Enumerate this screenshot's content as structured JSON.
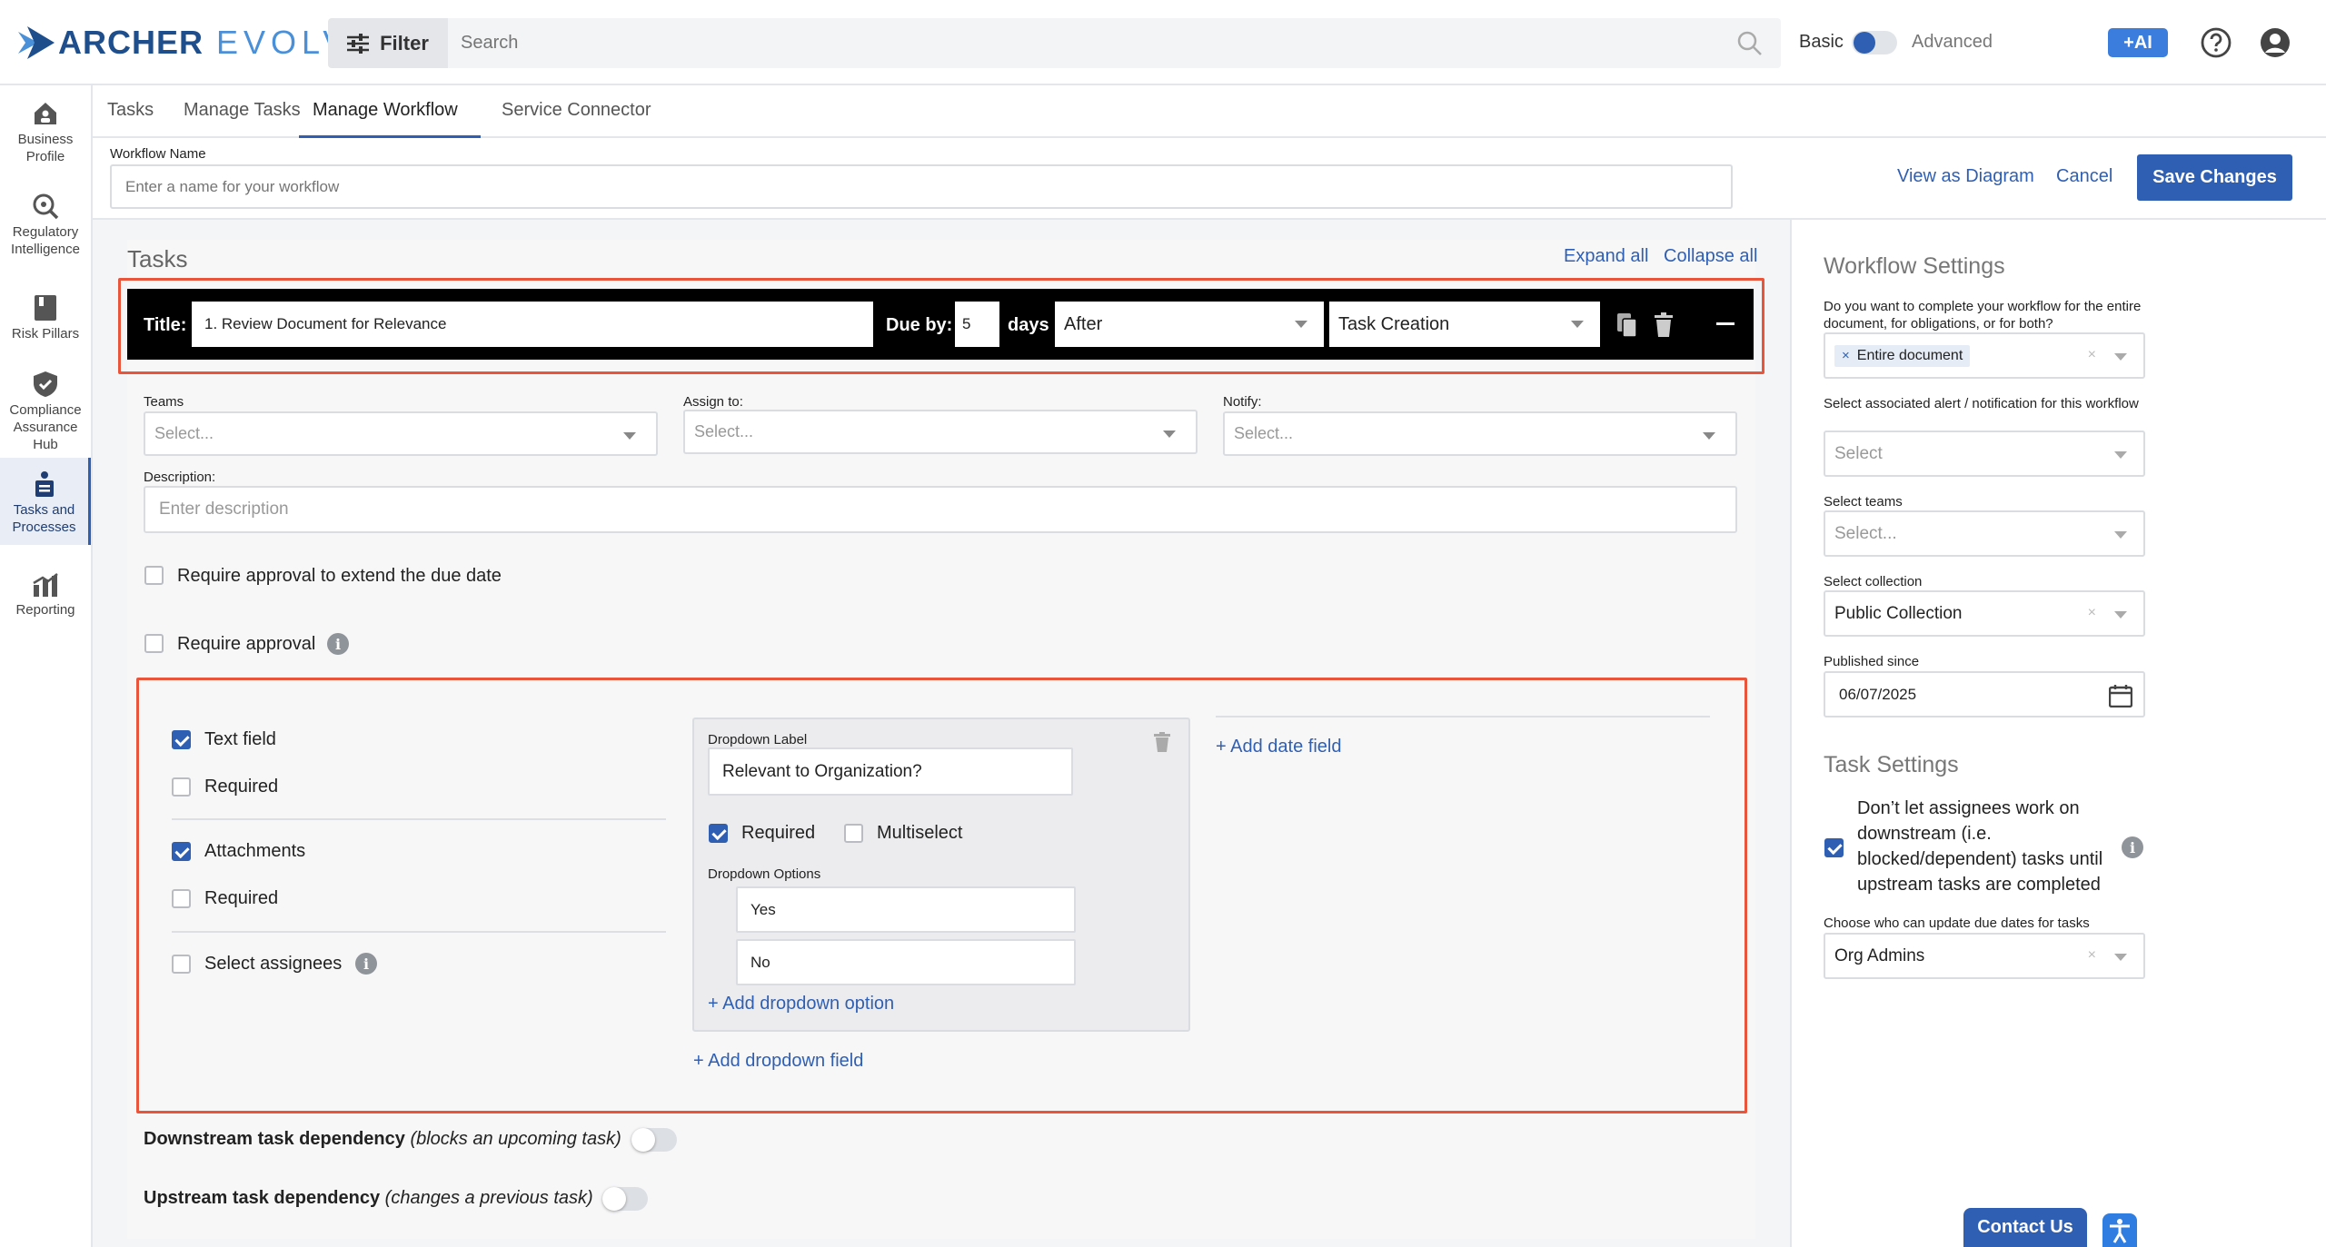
{
  "brand": {
    "name_part1": "ARCHER",
    "name_part2": "EVOLV"
  },
  "topbar": {
    "filter_label": "Filter",
    "search_placeholder": "Search",
    "basic_label": "Basic",
    "advanced_label": "Advanced",
    "ai_label": "+AI"
  },
  "nav": {
    "items": [
      {
        "label": "Business Profile",
        "icon": "home-icon"
      },
      {
        "label": "Regulatory Intelligence",
        "icon": "magnifier-icon"
      },
      {
        "label": "Risk Pillars",
        "icon": "document-icon"
      },
      {
        "label": "Compliance Assurance Hub",
        "icon": "shield-icon"
      },
      {
        "label": "Tasks and Processes",
        "icon": "tasks-icon"
      },
      {
        "label": "Reporting",
        "icon": "chart-icon"
      }
    ],
    "active": "Tasks and Processes"
  },
  "tabs": [
    "Tasks",
    "Manage Tasks",
    "Manage Workflow",
    "Service Connector"
  ],
  "active_tab": "Manage Workflow",
  "workflow": {
    "name_label": "Workflow Name",
    "name_placeholder": "Enter a name for your workflow",
    "view_diagram": "View as Diagram",
    "cancel": "Cancel",
    "save": "Save Changes"
  },
  "tasks": {
    "heading": "Tasks",
    "expand_all": "Expand all",
    "collapse_all": "Collapse all",
    "task": {
      "title_label": "Title:",
      "title_value": "1. Review Document for Relevance",
      "due_by_label": "Due by:",
      "due_value": "5",
      "days_label": "days",
      "relation": "After",
      "anchor": "Task Creation",
      "teams_label": "Teams",
      "teams_placeholder": "Select...",
      "assign_label": "Assign to:",
      "assign_placeholder": "Select...",
      "notify_label": "Notify:",
      "notify_placeholder": "Select...",
      "description_label": "Description:",
      "description_placeholder": "Enter description",
      "require_extend": "Require approval to extend the due date",
      "require_approval": "Require approval",
      "fields": {
        "text_field": "Text field",
        "text_required": "Required",
        "attachments": "Attachments",
        "attachments_required": "Required",
        "select_assignees": "Select assignees",
        "dropdown_label_caption": "Dropdown Label",
        "dropdown_label_value": "Relevant to Organization?",
        "dd_required": "Required",
        "dd_multiselect": "Multiselect",
        "dropdown_options_caption": "Dropdown Options",
        "options": [
          "Yes",
          "No"
        ],
        "add_option": "+ Add dropdown option",
        "add_dropdown_field": "+ Add dropdown field",
        "add_date_field": "+ Add date field"
      },
      "downstream_bold": "Downstream task dependency",
      "downstream_italic": "(blocks an upcoming task)",
      "upstream_bold": "Upstream task dependency",
      "upstream_italic": "(changes a previous task)"
    }
  },
  "settings": {
    "workflow_title": "Workflow Settings",
    "complete_q": "Do you want to complete your workflow for the entire document, for obligations, or for both?",
    "complete_value": "Entire document",
    "alert_label": "Select associated alert / notification for this workflow",
    "alert_placeholder": "Select",
    "teams_label": "Select teams",
    "teams_placeholder": "Select...",
    "collection_label": "Select collection",
    "collection_value": "Public Collection",
    "published_label": "Published since",
    "published_value": "06/07/2025",
    "task_title": "Task Settings",
    "dont_let": "Don’t let assignees work on downstream (i.e. blocked/dependent) tasks until upstream tasks are completed",
    "update_due_label": "Choose who can update due dates for tasks",
    "update_due_value": "Org Admins"
  },
  "footer": {
    "contact": "Contact Us"
  },
  "colors": {
    "accent": "#2f5fb3",
    "highlight": "#e8553b",
    "ai": "#3b7ddd"
  }
}
